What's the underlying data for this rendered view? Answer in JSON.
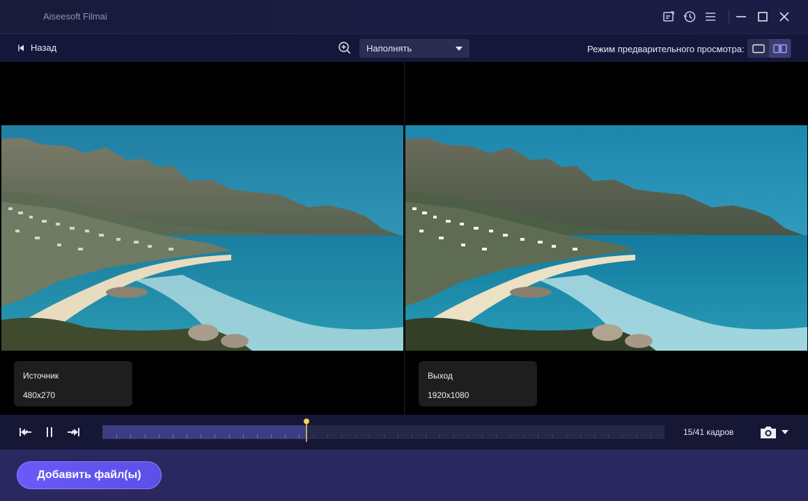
{
  "app": {
    "title": "Aiseesoft Filmai"
  },
  "titlebar_icons": [
    "feedback-icon",
    "history-icon",
    "menu-icon",
    "minimize-icon",
    "maximize-icon",
    "close-icon"
  ],
  "toolbar": {
    "back_label": "Назад",
    "zoom_icon": "zoom-in-icon",
    "fill_mode_selected": "Наполнять",
    "preview_mode_label": "Режим предварительного просмотра:",
    "preview_modes": [
      "single-view-icon",
      "split-view-icon"
    ],
    "active_preview_mode": "split-view-icon"
  },
  "source": {
    "label": "Источник",
    "resolution": "480x270"
  },
  "output": {
    "label": "Выход",
    "resolution": "1920x1080"
  },
  "playback": {
    "current_frame": 15,
    "total_frames": 41,
    "frames_text": "15/41 кадров",
    "controls": [
      "prev-frame-icon",
      "pause-icon",
      "next-frame-icon"
    ],
    "screenshot_icon": "camera-icon"
  },
  "footer": {
    "add_files_label": "Добавить файл(ы)"
  },
  "colors": {
    "accent": "#6a5af9",
    "playhead": "#f3d35b",
    "track_fill": "#3a3d82"
  }
}
